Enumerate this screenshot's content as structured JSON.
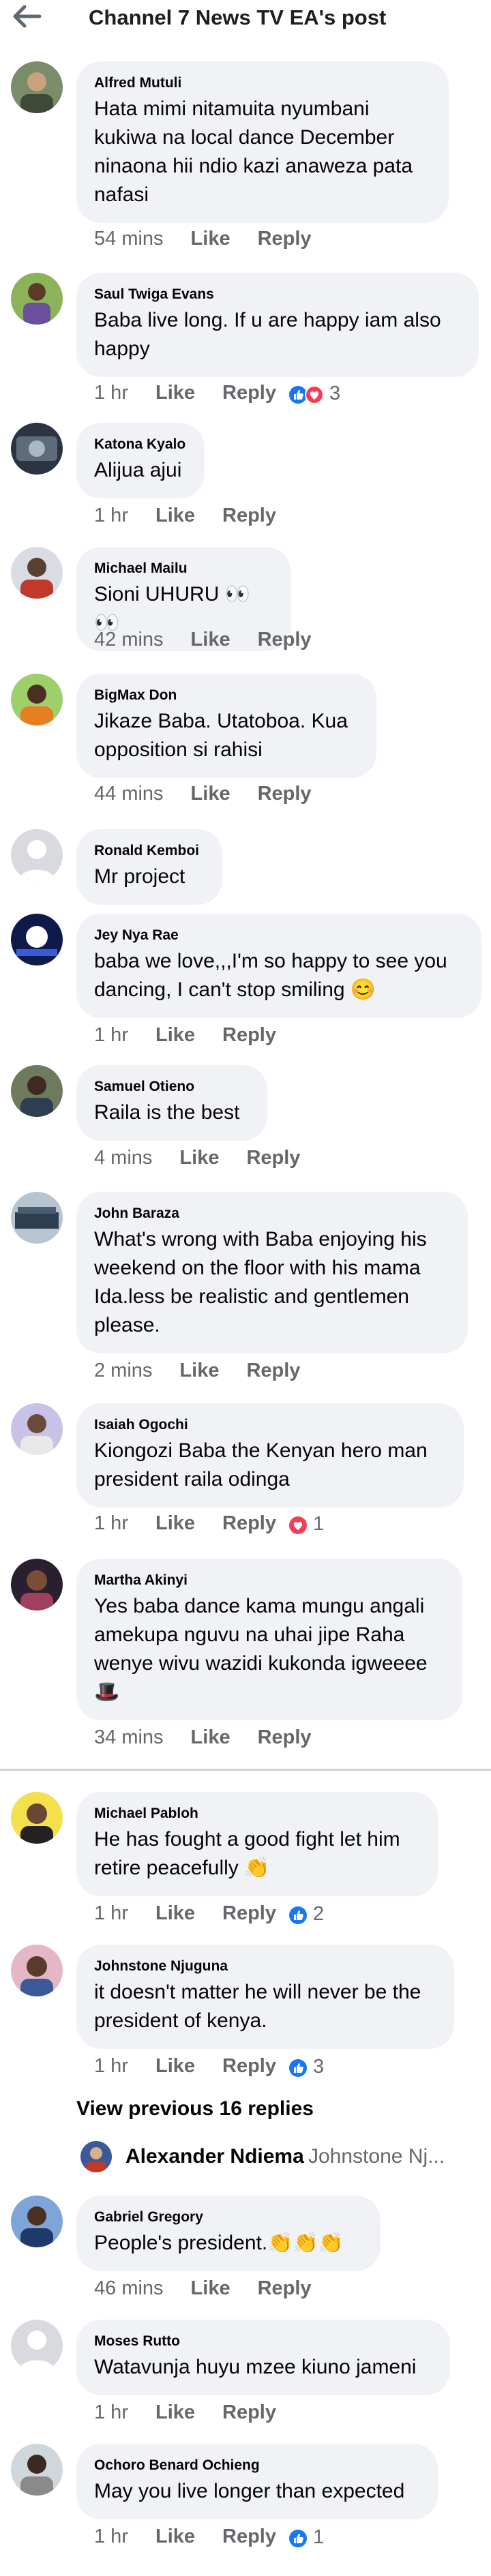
{
  "header": {
    "title": "Channel 7 News TV EA's post",
    "back_icon": "back-arrow-icon"
  },
  "colors": {
    "bubble": "#f0f2f5",
    "meta": "#65676b",
    "like_blue": "#1877f2",
    "love_red": "#f33e58"
  },
  "comments": [
    {
      "author": "Alfred Mutuli",
      "text": "Hata mimi nitamuita nyumbani kukiwa na local dance December ninaona hii ndio kazi anaweza pata nafasi",
      "time": "54 mins",
      "like": "Like",
      "reply": "Reply",
      "reactions": "",
      "count": ""
    },
    {
      "author": "Saul Twiga Evans",
      "text": "Baba live long. If u are happy iam also happy",
      "time": "1 hr",
      "like": "Like",
      "reply": "Reply",
      "reactions": "like,love",
      "count": "3"
    },
    {
      "author": "Katona Kyalo",
      "text": "Alijua ajui",
      "time": "1 hr",
      "like": "Like",
      "reply": "Reply",
      "reactions": "",
      "count": ""
    },
    {
      "author": "Michael Mailu",
      "text": "Sioni UHURU 👀👀",
      "time": "42 mins",
      "like": "Like",
      "reply": "Reply",
      "reactions": "",
      "count": ""
    },
    {
      "author": "BigMax Don",
      "text": "Jikaze Baba. Utatoboa. Kua opposition si rahisi",
      "time": "44 mins",
      "like": "Like",
      "reply": "Reply",
      "reactions": "",
      "count": ""
    },
    {
      "author": "Ronald Kemboi",
      "text": "Mr project",
      "time": "",
      "like": "",
      "reply": "",
      "reactions": "",
      "count": ""
    },
    {
      "author": "Jey Nya Rae",
      "text": "baba we love,,,I'm so happy to see you dancing, I can't stop smiling 😊",
      "time": "1 hr",
      "like": "Like",
      "reply": "Reply",
      "reactions": "",
      "count": ""
    },
    {
      "author": "Samuel Otieno",
      "text": "Raila is the best",
      "time": "4 mins",
      "like": "Like",
      "reply": "Reply",
      "reactions": "",
      "count": ""
    },
    {
      "author": "John Baraza",
      "text": "What's wrong with Baba enjoying his weekend on the floor with his mama Ida.less be realistic and gentlemen please.",
      "time": "2 mins",
      "like": "Like",
      "reply": "Reply",
      "reactions": "",
      "count": ""
    },
    {
      "author": "Isaiah Ogochi",
      "text": "Kiongozi Baba the Kenyan hero man president raila odinga",
      "time": "1 hr",
      "like": "Like",
      "reply": "Reply",
      "reactions": "love",
      "count": "1"
    },
    {
      "author": "Martha Akinyi",
      "text": "Yes baba dance kama mungu angali amekupa nguvu na uhai jipe Raha wenye wivu wazidi kukonda igweeee🎩",
      "time": "34 mins",
      "like": "Like",
      "reply": "Reply",
      "reactions": "",
      "count": ""
    },
    {
      "author": "Michael Pabloh",
      "text": "He has fought a good fight let him retire peacefully 👏",
      "time": "1 hr",
      "like": "Like",
      "reply": "Reply",
      "reactions": "like",
      "count": "2"
    },
    {
      "author": "Johnstone Njuguna",
      "text": "it doesn't matter he will never be the president of kenya.",
      "time": "1 hr",
      "like": "Like",
      "reply": "Reply",
      "reactions": "like",
      "count": "3"
    },
    {
      "author": "Gabriel Gregory",
      "text": "People's president.👏👏👏",
      "time": "46 mins",
      "like": "Like",
      "reply": "Reply",
      "reactions": "",
      "count": ""
    },
    {
      "author": "Moses Rutto",
      "text": "Watavunja huyu mzee kiuno jameni",
      "time": "1 hr",
      "like": "Like",
      "reply": "Reply",
      "reactions": "",
      "count": ""
    },
    {
      "author": "Ochoro Benard Ochieng",
      "text": "May you live longer than expected",
      "time": "1 hr",
      "like": "Like",
      "reply": "Reply",
      "reactions": "like",
      "count": "1"
    }
  ],
  "view_previous": "View previous 16 replies",
  "reply_preview": {
    "name": "Alexander Ndiema",
    "to": "Johnstone Nj..."
  }
}
